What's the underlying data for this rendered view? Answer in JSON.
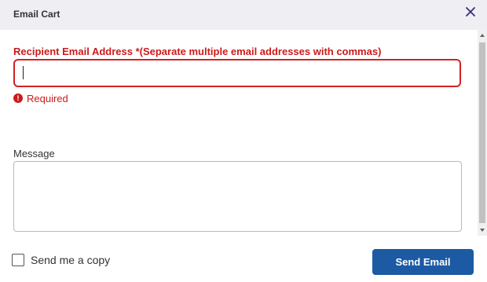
{
  "header": {
    "title": "Email Cart",
    "close_icon": "close-icon"
  },
  "form": {
    "recipient": {
      "label": "Recipient Email Address *(Separate multiple email addresses with commas)",
      "value": "",
      "error_icon": "exclamation-circle-icon",
      "error_text": "Required"
    },
    "message": {
      "label": "Message",
      "value": ""
    }
  },
  "footer": {
    "copy_label": "Send me a copy",
    "copy_checked": false,
    "send_label": "Send Email"
  },
  "colors": {
    "header_bg": "#efeff3",
    "error": "#cc1a1a",
    "primary_button": "#1c5aa3",
    "close_icon": "#3d2a78"
  }
}
